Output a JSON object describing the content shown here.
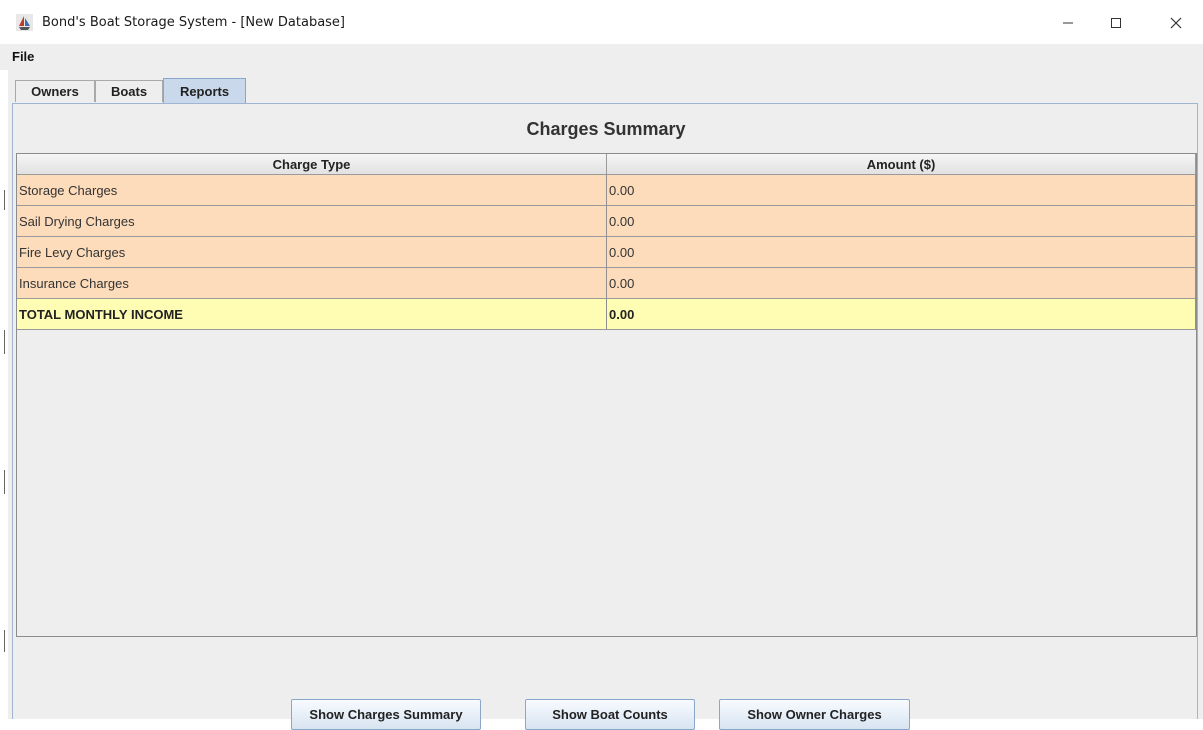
{
  "window": {
    "title": "Bond's Boat Storage System - [New Database]",
    "icon": "boat-storage-app-icon",
    "controls": [
      "minimize",
      "maximize",
      "close"
    ]
  },
  "menu": {
    "file": "File"
  },
  "tabs": [
    {
      "label": "Owners",
      "active": false
    },
    {
      "label": "Boats",
      "active": false
    },
    {
      "label": "Reports",
      "active": true
    }
  ],
  "report": {
    "title": "Charges Summary",
    "columns": [
      "Charge Type",
      "Amount ($)"
    ],
    "rows": [
      {
        "type": "Storage Charges",
        "amount": "0.00"
      },
      {
        "type": "Sail Drying Charges",
        "amount": "0.00"
      },
      {
        "type": "Fire Levy Charges",
        "amount": "0.00"
      },
      {
        "type": "Insurance Charges",
        "amount": "0.00"
      }
    ],
    "total": {
      "type": "TOTAL MONTHLY INCOME",
      "amount": "0.00"
    }
  },
  "buttons": {
    "charges_summary": "Show Charges Summary",
    "boat_counts": "Show Boat Counts",
    "owner_charges": "Show Owner Charges"
  },
  "colors": {
    "row_background": "#fddcbb",
    "total_background": "#fffdb3",
    "active_tab": "#c9d9eb"
  }
}
